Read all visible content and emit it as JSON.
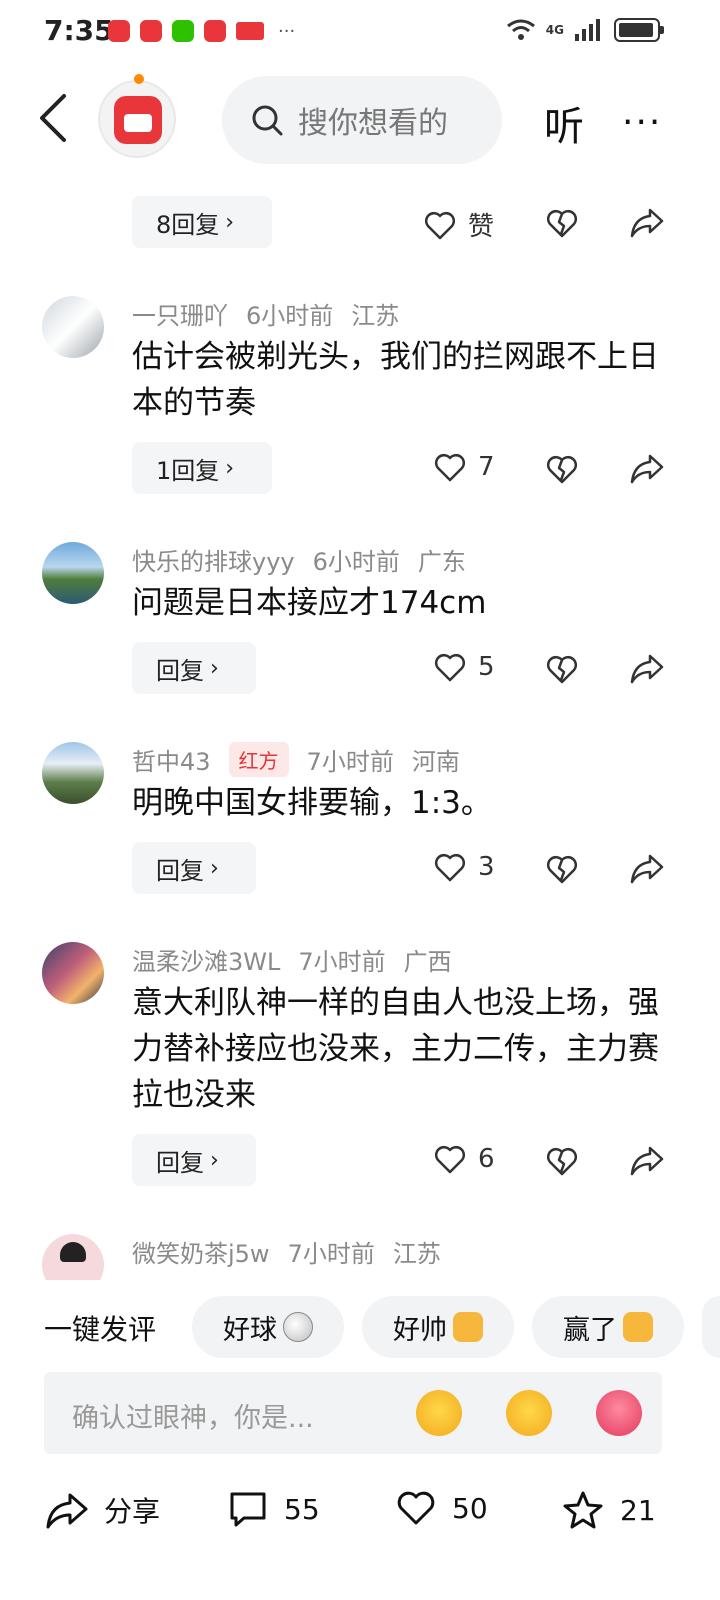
{
  "status_bar": {
    "time": "7:35",
    "network": "4G",
    "dots": "···"
  },
  "header": {
    "search_placeholder": "搜你想看的",
    "listen_label": "听",
    "more_label": "···"
  },
  "first_actions": {
    "reply_label": "8回复",
    "like_label": "赞"
  },
  "comments": [
    {
      "user": "一只珊吖",
      "time": "6小时前",
      "region": "江苏",
      "tag": "",
      "text": "估计会被剃光头，我们的拦网跟不上日本的节奏",
      "reply_label": "1回复",
      "likes": "7"
    },
    {
      "user": "快乐的排球yyy",
      "time": "6小时前",
      "region": "广东",
      "tag": "",
      "text": "问题是日本接应才174cm",
      "reply_label": "回复",
      "likes": "5"
    },
    {
      "user": "哲中43",
      "time": "7小时前",
      "region": "河南",
      "tag": "红方",
      "text": "明晚中国女排要输，1:3。",
      "reply_label": "回复",
      "likes": "3"
    },
    {
      "user": "温柔沙滩3WL",
      "time": "7小时前",
      "region": "广西",
      "tag": "",
      "text": "意大利队神一样的自由人也没上场，强力替补接应也没来，主力二传，主力赛拉也没来",
      "reply_label": "回复",
      "likes": "6"
    },
    {
      "user": "微笑奶茶j5w",
      "time": "7小时前",
      "region": "江苏",
      "tag": ""
    }
  ],
  "quick_reply": {
    "label": "一键发评",
    "chips": [
      "好球",
      "好帅",
      "赢了"
    ]
  },
  "input": {
    "placeholder": "确认过眼神，你是..."
  },
  "bottom_bar": {
    "share_label": "分享",
    "comments_count": "55",
    "likes_count": "50",
    "favorites_count": "21"
  },
  "colors": {
    "accent_red": "#e8363b",
    "tag_bg": "#fde8e8",
    "chip_bg": "#f2f3f5"
  }
}
